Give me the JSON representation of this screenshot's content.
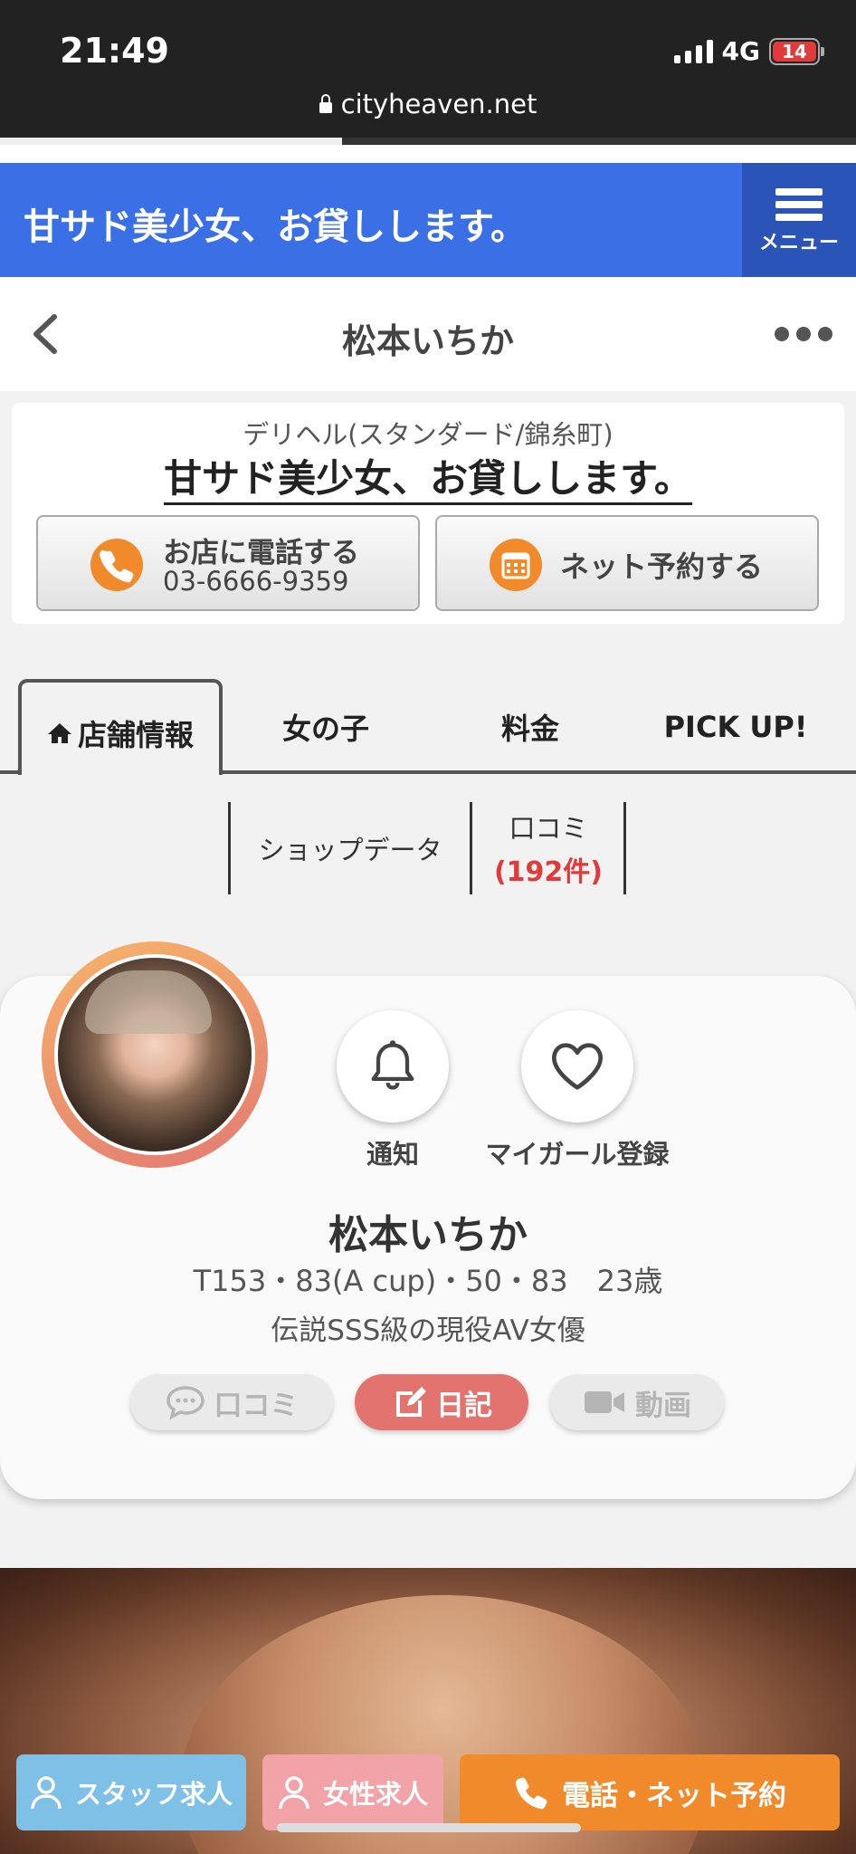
{
  "status_bar": {
    "time": "21:49",
    "network": "4G",
    "battery": "14",
    "url": "cityheaven.net"
  },
  "shop_bar": {
    "title": "甘サド美少女、お貸しします。",
    "menu_label": "メニュー"
  },
  "nav": {
    "title": "松本いちか"
  },
  "shop_card": {
    "genre": "デリヘル(スタンダード/錦糸町)",
    "name": "甘サド美少女、お貸しします。",
    "call_label": "お店に電話する",
    "call_number": "03-6666-9359",
    "reserve_label": "ネット予約する"
  },
  "tabs": [
    {
      "label": "店舗情報",
      "active": true
    },
    {
      "label": "女の子"
    },
    {
      "label": "料金"
    },
    {
      "label": "PICK UP!"
    }
  ],
  "sub_tabs": {
    "shop_data": "ショップデータ",
    "review": "口コミ",
    "review_count": "(192件)"
  },
  "profile": {
    "notify_label": "通知",
    "fav_label": "マイガール登録",
    "name": "松本いちか",
    "stats": "T153・83(A cup)・50・83　23歳",
    "catch": "伝説SSS級の現役AV女優",
    "review_pill": "口コミ",
    "diary_pill": "日記",
    "video_pill": "動画"
  },
  "bottom_bar": {
    "staff": "スタッフ求人",
    "female": "女性求人",
    "call": "電話・ネット予約"
  },
  "colors": {
    "brand_blue": "#3b6fe6",
    "accent_orange": "#f08a2a",
    "diary_red": "#e3736f",
    "review_count_red": "#e03a3a"
  }
}
